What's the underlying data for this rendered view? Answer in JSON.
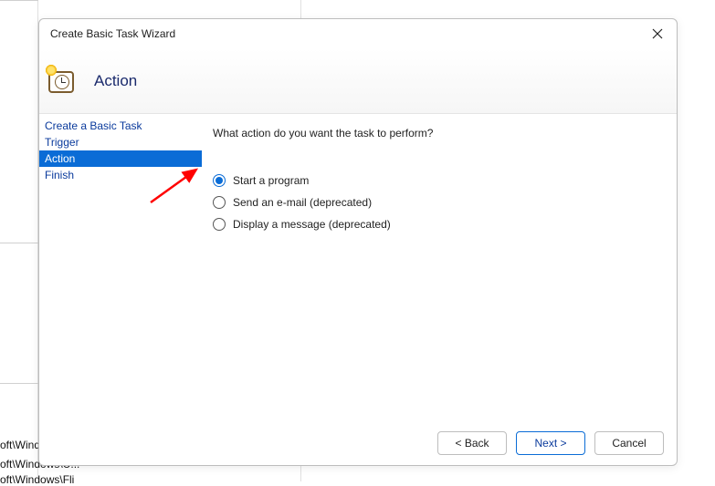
{
  "background": {
    "row1": "oft\\Wind...",
    "row2": "oft\\Windows\\U...",
    "row3": "oft\\Windows\\Fli"
  },
  "dialog": {
    "title": "Create Basic Task Wizard",
    "heading": "Action",
    "nav": [
      {
        "label": "Create a Basic Task",
        "selected": false
      },
      {
        "label": "Trigger",
        "selected": false
      },
      {
        "label": "Action",
        "selected": true
      },
      {
        "label": "Finish",
        "selected": false
      }
    ],
    "prompt": "What action do you want the task to perform?",
    "options": [
      {
        "label": "Start a program",
        "selected": true
      },
      {
        "label": "Send an e-mail (deprecated)",
        "selected": false
      },
      {
        "label": "Display a message (deprecated)",
        "selected": false
      }
    ],
    "buttons": {
      "back": "< Back",
      "next": "Next >",
      "cancel": "Cancel"
    }
  },
  "annotation": {
    "arrow_color": "#ff0000"
  }
}
